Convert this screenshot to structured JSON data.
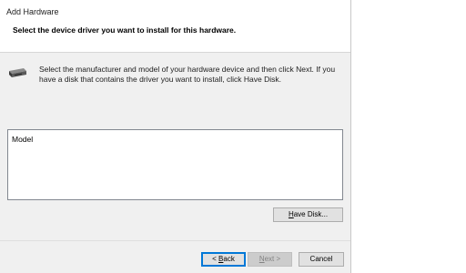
{
  "window": {
    "title": "Add Hardware"
  },
  "header": {
    "subtitle": "Select the device driver you want to install for this hardware."
  },
  "info": {
    "icon": "device-driver-icon",
    "text": "Select the manufacturer and model of your hardware device and then click Next. If you have a disk that contains the driver you want to install, click Have Disk."
  },
  "model_list": {
    "header": "Model",
    "items": []
  },
  "buttons": {
    "have_disk": {
      "accel": "H",
      "rest": "ave Disk..."
    },
    "back": {
      "prefix": "< ",
      "accel": "B",
      "rest": "ack"
    },
    "next": {
      "accel": "N",
      "rest": "ext >"
    },
    "cancel": "Cancel"
  },
  "colors": {
    "dialog_bg": "#f0f0f0",
    "header_bg": "#ffffff",
    "default_button_border": "#0078d7"
  }
}
